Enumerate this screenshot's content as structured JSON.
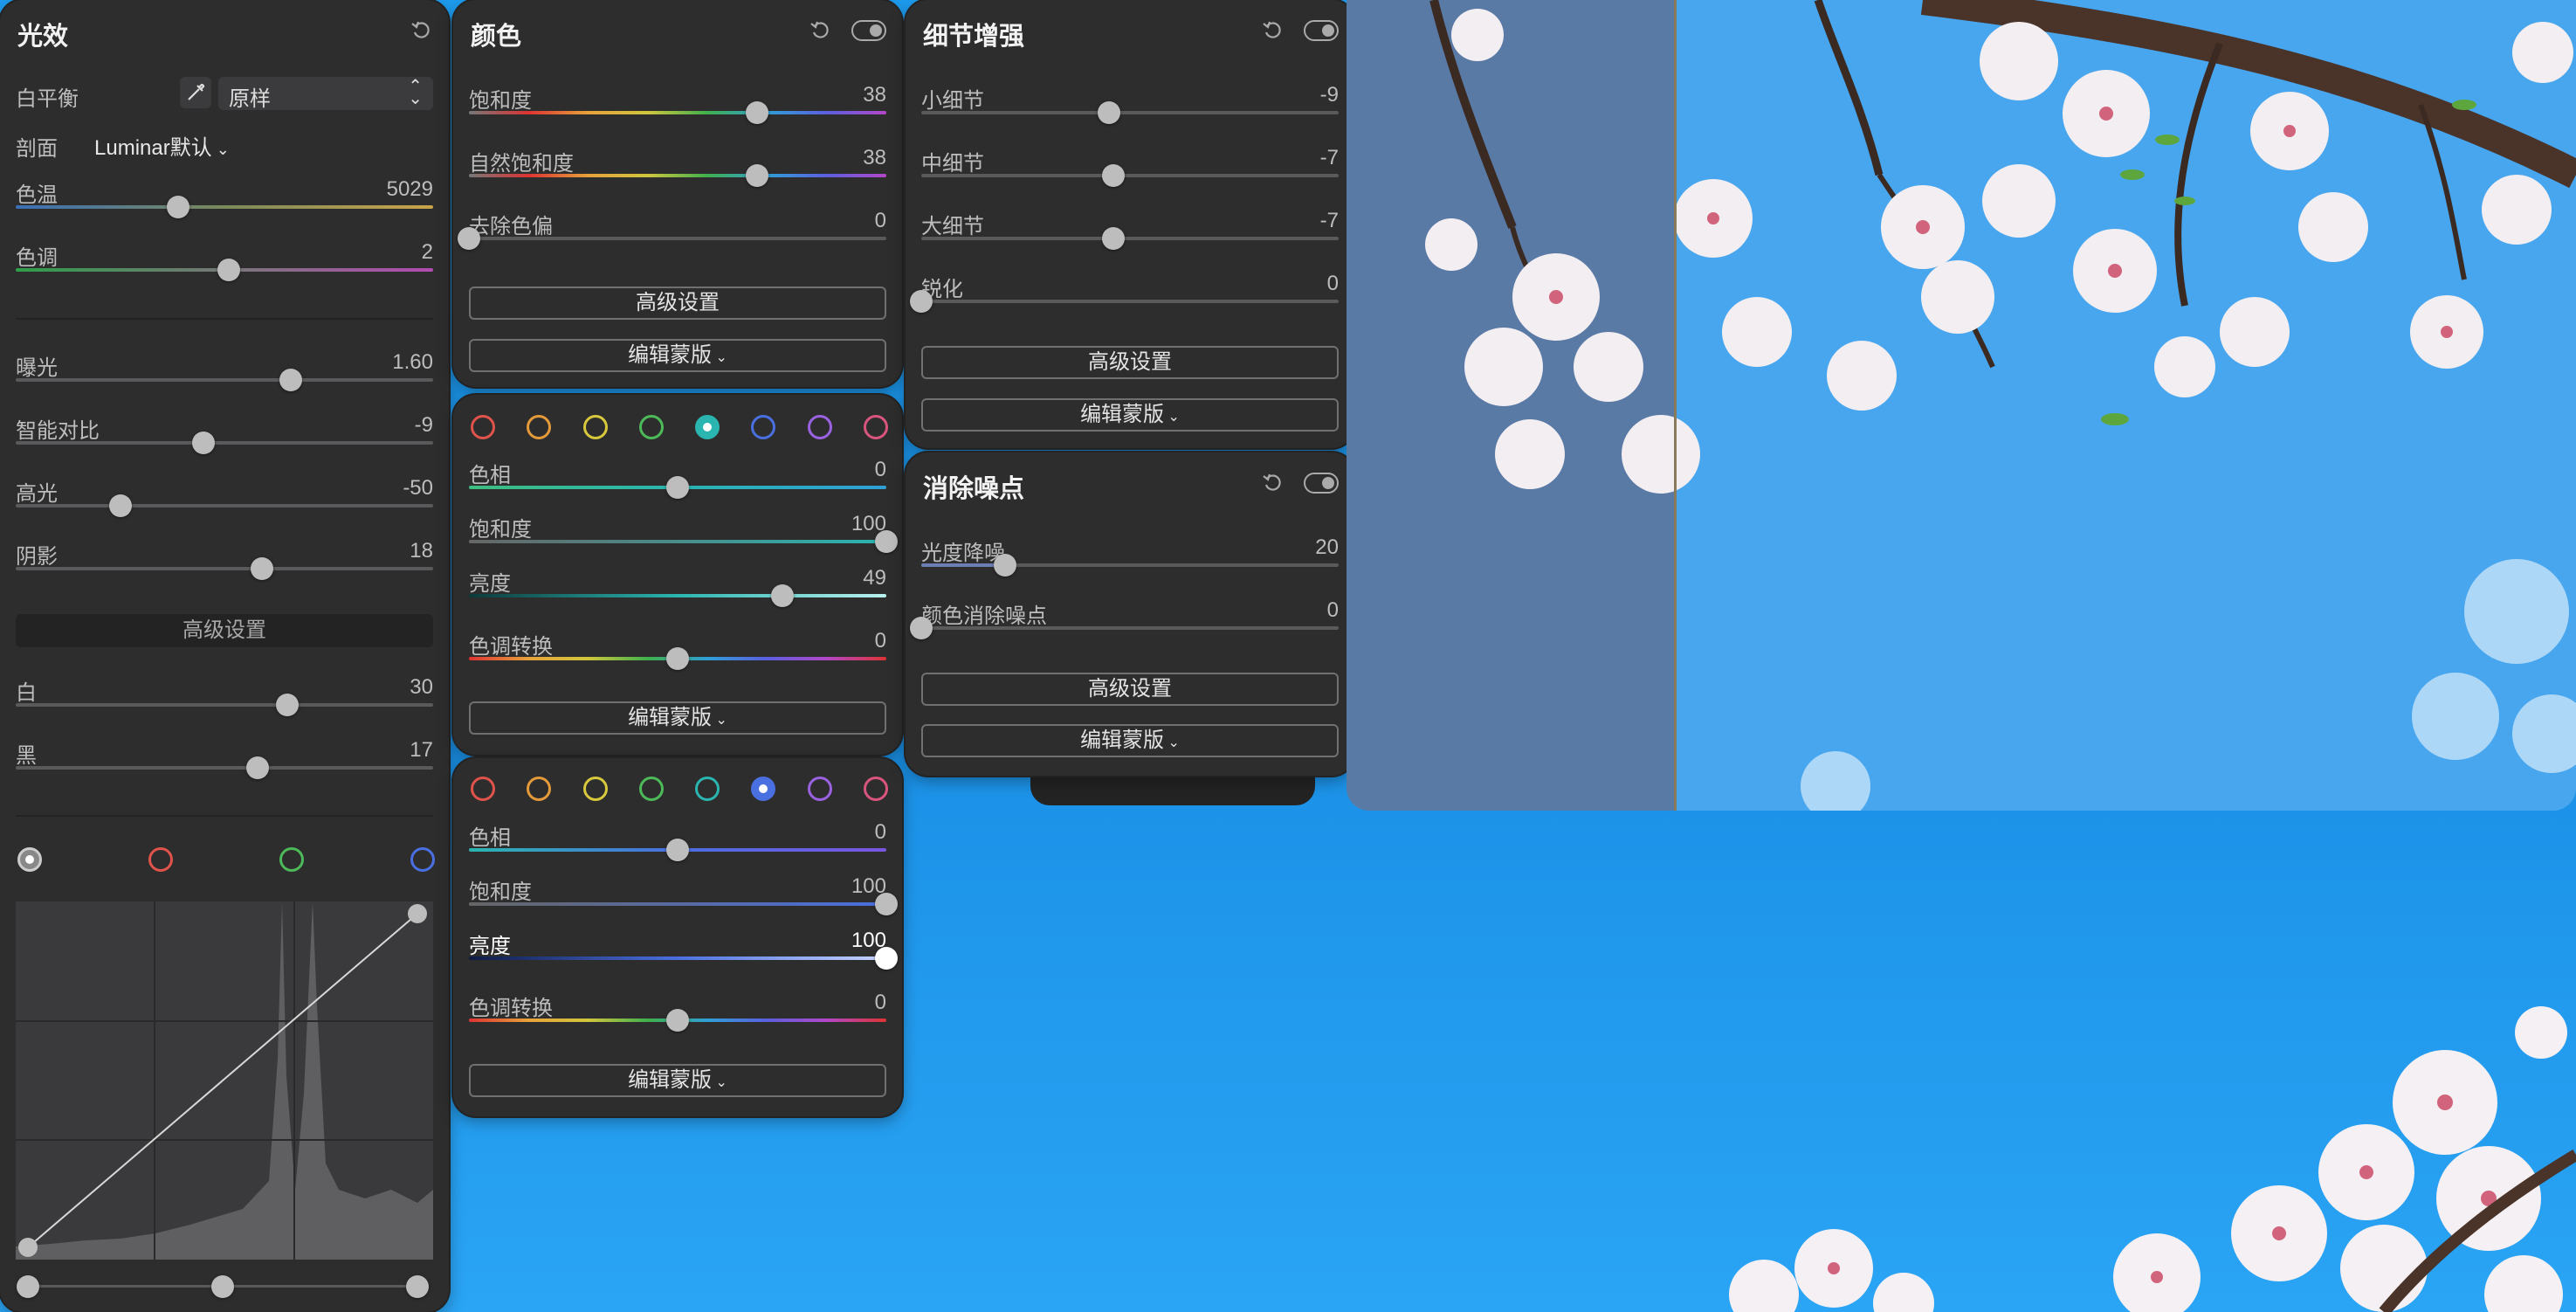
{
  "light": {
    "title": "光效",
    "wb_label": "白平衡",
    "wb_value": "原样",
    "profile_label": "剖面",
    "profile_value": "Luminar默认",
    "temp": {
      "label": "色温",
      "value": "5029",
      "pos": 0.39
    },
    "tint": {
      "label": "色调",
      "value": "2",
      "pos": 0.51
    },
    "exposure": {
      "label": "曝光",
      "value": "1.60",
      "pos": 0.66
    },
    "smart_contrast": {
      "label": "智能对比",
      "value": "-9",
      "pos": 0.45
    },
    "highlights": {
      "label": "高光",
      "value": "-50",
      "pos": 0.25
    },
    "shadows": {
      "label": "阴影",
      "value": "18",
      "pos": 0.59
    },
    "advanced": "高级设置",
    "whites": {
      "label": "白",
      "value": "30",
      "pos": 0.65
    },
    "blacks": {
      "label": "黑",
      "value": "17",
      "pos": 0.58
    }
  },
  "color": {
    "title": "颜色",
    "saturation": {
      "label": "饱和度",
      "value": "38",
      "pos": 0.69
    },
    "vibrance": {
      "label": "自然饱和度",
      "value": "38",
      "pos": 0.69
    },
    "remove_cast": {
      "label": "去除色偏",
      "value": "0",
      "pos": 0.0
    },
    "advanced": "高级设置",
    "mask": "编辑蒙版"
  },
  "hsl1": {
    "hue": {
      "label": "色相",
      "value": "0",
      "pos": 0.5
    },
    "saturation": {
      "label": "饱和度",
      "value": "100",
      "pos": 1.0
    },
    "luminance": {
      "label": "亮度",
      "value": "49",
      "pos": 0.75
    },
    "shift": {
      "label": "色调转换",
      "value": "0",
      "pos": 0.5
    },
    "mask": "编辑蒙版"
  },
  "hsl2": {
    "hue": {
      "label": "色相",
      "value": "0",
      "pos": 0.5
    },
    "saturation": {
      "label": "饱和度",
      "value": "100",
      "pos": 1.0
    },
    "luminance": {
      "label": "亮度",
      "value": "100",
      "pos": 1.0
    },
    "shift": {
      "label": "色调转换",
      "value": "0",
      "pos": 0.5
    },
    "mask": "编辑蒙版"
  },
  "details": {
    "title": "细节增强",
    "small": {
      "label": "小细节",
      "value": "-9",
      "pos": 0.45
    },
    "medium": {
      "label": "中细节",
      "value": "-7",
      "pos": 0.46
    },
    "large": {
      "label": "大细节",
      "value": "-7",
      "pos": 0.46
    },
    "sharpen": {
      "label": "锐化",
      "value": "0",
      "pos": 0.0
    },
    "advanced": "高级设置",
    "mask": "编辑蒙版"
  },
  "denoise": {
    "title": "消除噪点",
    "luminance": {
      "label": "光度降噪",
      "value": "20",
      "pos": 0.2
    },
    "color": {
      "label": "颜色消除噪点",
      "value": "0",
      "pos": 0.0
    },
    "advanced": "高级设置",
    "mask": "编辑蒙版"
  },
  "colors": {
    "swatches": [
      "#e0534b",
      "#e59a3a",
      "#d8c83c",
      "#4dba5a",
      "#2ab5b0",
      "#4a6fe0",
      "#9a62e0",
      "#d9557e"
    ],
    "hsl1_selected": 4,
    "hsl2_selected": 5
  }
}
